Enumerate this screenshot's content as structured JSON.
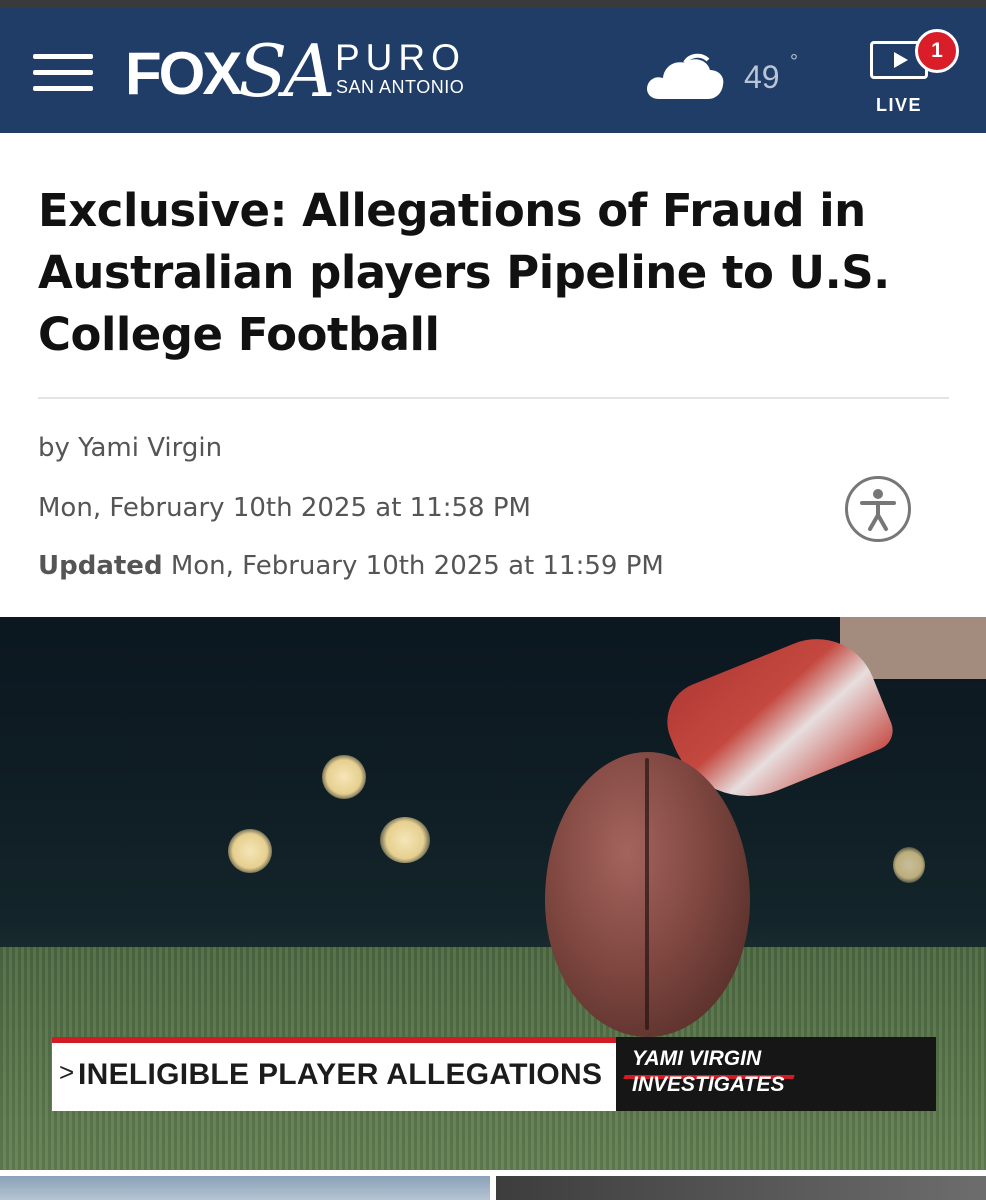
{
  "header": {
    "menu_icon": "hamburger-menu-icon",
    "logo": {
      "fox": "FOX",
      "sa": "SA",
      "puro": "PURO",
      "sub": "SAN ANTONIO"
    },
    "weather": {
      "icon": "cloud-icon",
      "temperature": "49",
      "degree_symbol": "°"
    },
    "live": {
      "icon": "play-video-icon",
      "badge_count": "1",
      "label": "LIVE"
    },
    "colors": {
      "header_bg": "#1f3d66",
      "badge_red": "#d91e2a"
    }
  },
  "article": {
    "headline": "Exclusive: Allegations of Fraud in Australian players Pipeline to U.S. College Football",
    "byline": "by Yami Virgin",
    "published": "Mon, February 10th 2025 at 11:58 PM",
    "updated_label": "Updated",
    "updated": "Mon, February 10th 2025 at 11:59 PM",
    "accessibility_icon": "accessibility-icon"
  },
  "hero_image": {
    "lower_third_arrow": ">",
    "lower_third_text": "INELIGIBLE PLAYER ALLEGATIONS",
    "reporter_line1": "YAMI VIRGIN",
    "reporter_line2": "INVESTIGATES",
    "accent_red": "#d11b25"
  }
}
